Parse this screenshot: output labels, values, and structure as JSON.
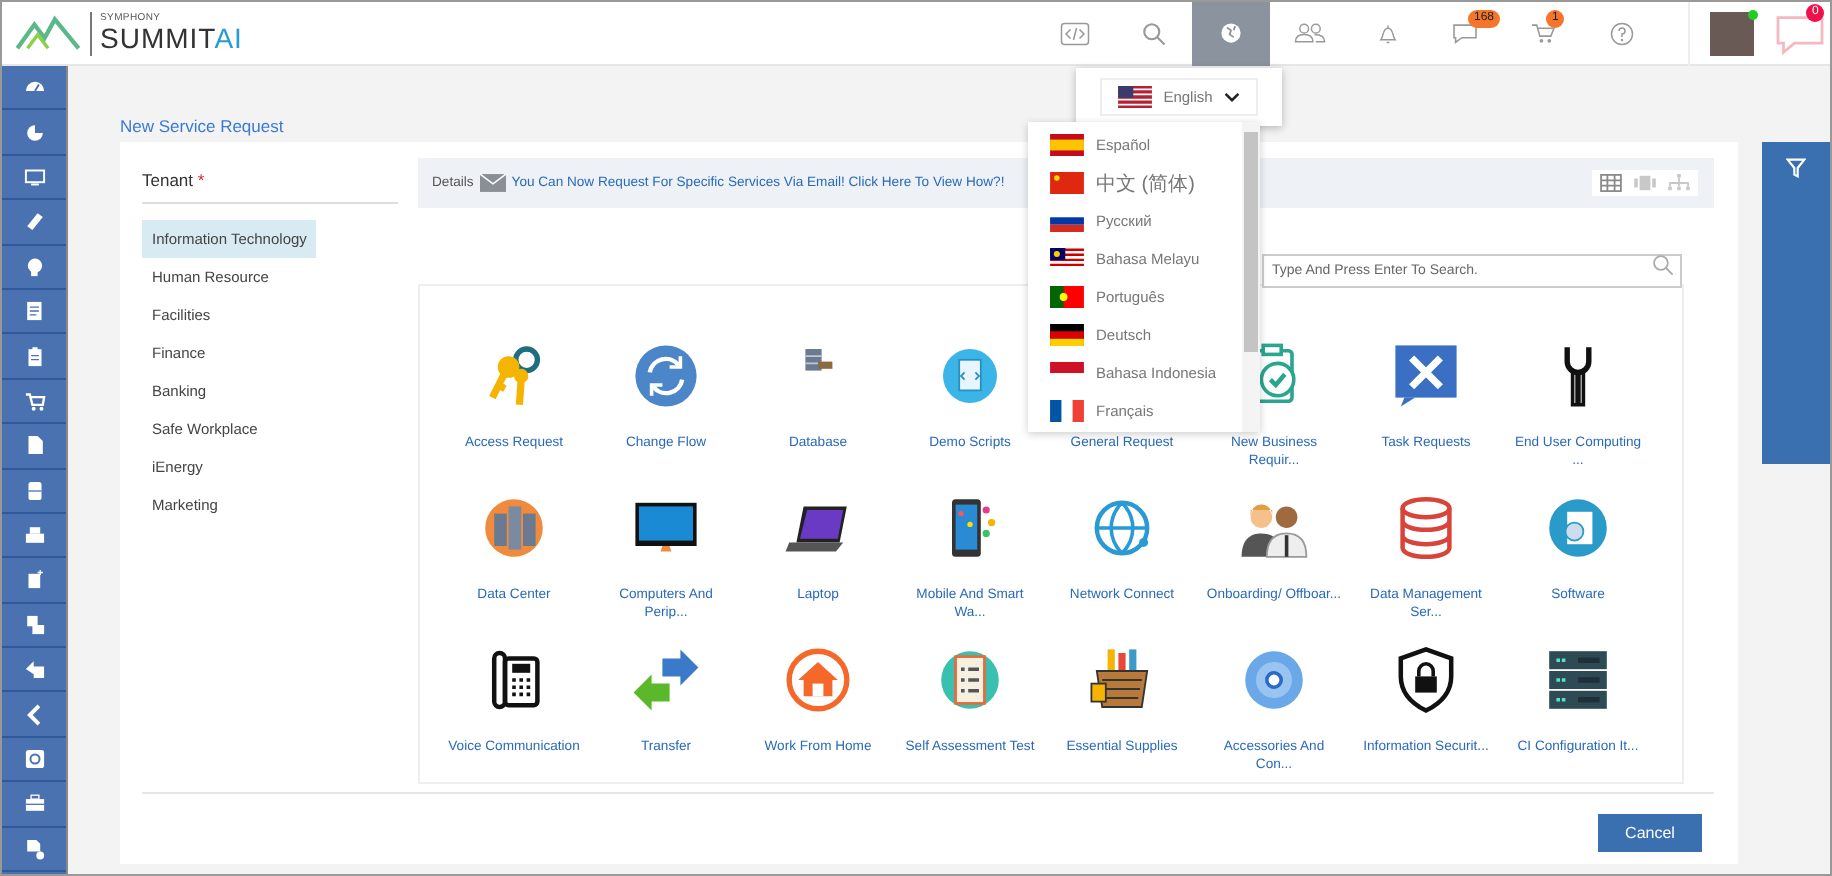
{
  "header": {
    "logo": {
      "tagline": "SYMPHONY",
      "name": "SUMMIT",
      "suffix": "AI"
    },
    "message_badge": "168",
    "cart_badge": "1",
    "chat_badge": "0",
    "user_online": true,
    "language_menu_open": true
  },
  "language": {
    "current": "English",
    "options": [
      {
        "label": "Español"
      },
      {
        "label": "中文 (简体)"
      },
      {
        "label": "Русский"
      },
      {
        "label": "Bahasa Melayu"
      },
      {
        "label": "Português"
      },
      {
        "label": "Deutsch"
      },
      {
        "label": "Bahasa Indonesia"
      },
      {
        "label": "Français"
      }
    ]
  },
  "page_title": "New Service Request",
  "tenant": {
    "label": "Tenant",
    "required_mark": "*",
    "items": [
      {
        "label": "Information Technology",
        "selected": true
      },
      {
        "label": "Human Resource",
        "selected": false
      },
      {
        "label": "Facilities",
        "selected": false
      },
      {
        "label": "Finance",
        "selected": false
      },
      {
        "label": "Banking",
        "selected": false
      },
      {
        "label": "Safe Workplace",
        "selected": false
      },
      {
        "label": "iEnergy",
        "selected": false
      },
      {
        "label": "Marketing",
        "selected": false
      }
    ]
  },
  "details": {
    "label": "Details",
    "message": "You Can Now Request For Specific Services Via Email! Click Here To View How?!"
  },
  "view_modes": [
    {
      "selected": true
    },
    {
      "selected": false
    },
    {
      "selected": false
    }
  ],
  "search": {
    "placeholder": "Type And Press Enter To Search."
  },
  "services": [
    {
      "label": "Access Request"
    },
    {
      "label": "Change Flow"
    },
    {
      "label": "Database"
    },
    {
      "label": "Demo Scripts"
    },
    {
      "label": "General Request"
    },
    {
      "label": "New Business Requir..."
    },
    {
      "label": "Task Requests"
    },
    {
      "label": "End User Computing ..."
    },
    {
      "label": "Data Center"
    },
    {
      "label": "Computers And Perip..."
    },
    {
      "label": "Laptop"
    },
    {
      "label": "Mobile And Smart Wa..."
    },
    {
      "label": "Network Connect"
    },
    {
      "label": "Onboarding/ Offboar..."
    },
    {
      "label": "Data Management Ser..."
    },
    {
      "label": "Software"
    },
    {
      "label": "Voice Communication"
    },
    {
      "label": "Transfer"
    },
    {
      "label": "Work From Home"
    },
    {
      "label": "Self Assessment Test"
    },
    {
      "label": "Essential Supplies"
    },
    {
      "label": "Accessories And Con..."
    },
    {
      "label": "Information Securit..."
    },
    {
      "label": "CI Configuration It..."
    }
  ],
  "buttons": {
    "cancel": "Cancel"
  }
}
